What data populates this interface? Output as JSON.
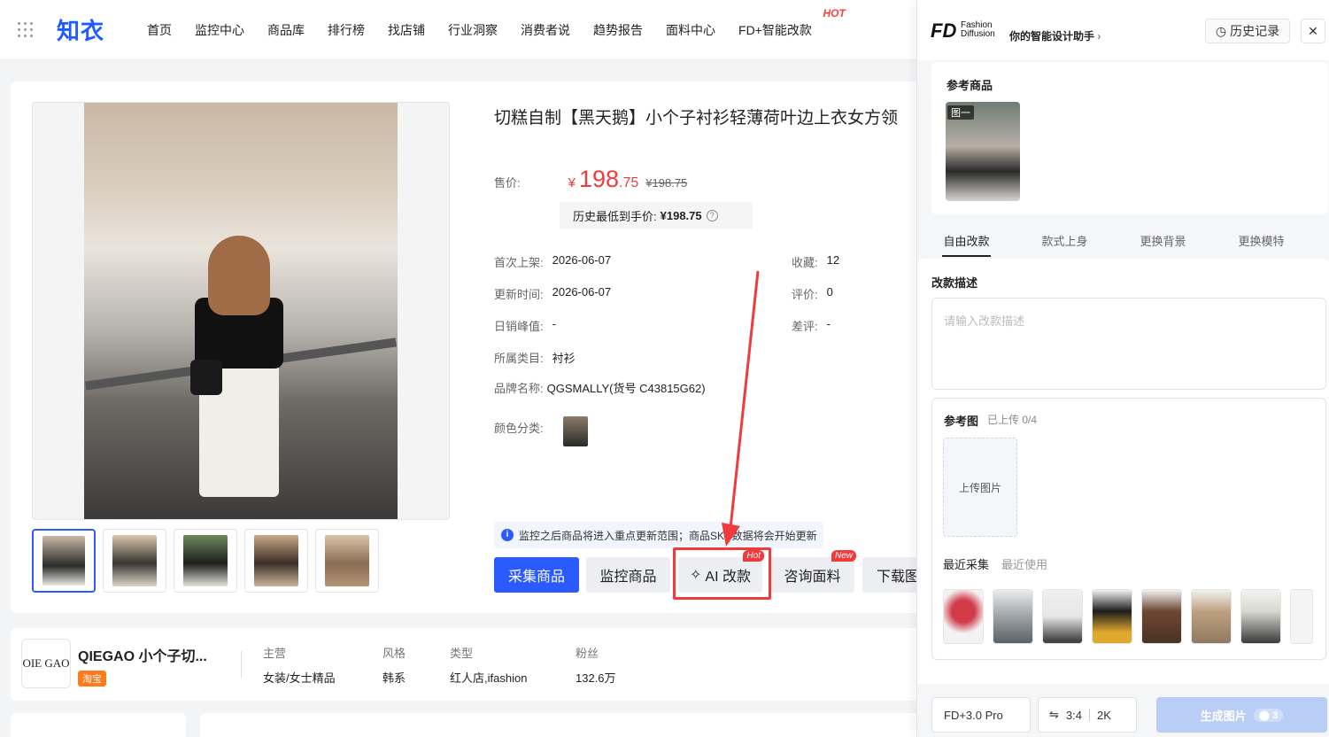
{
  "nav": {
    "logo": "知衣",
    "items": [
      "首页",
      "监控中心",
      "商品库",
      "排行榜",
      "找店铺",
      "行业洞察",
      "消费者说",
      "趋势报告",
      "面料中心",
      "FD+智能改款"
    ],
    "hot_badge": "HOT"
  },
  "product": {
    "title": "切糕自制【黑天鹅】小个子衬衫轻薄荷叶边上衣女方领",
    "price_label": "售价:",
    "currency": "¥",
    "price_int": "198",
    "price_dec": ".75",
    "price_old": "¥198.75",
    "history_label": "历史最低到手价:",
    "history_value": "¥198.75",
    "info_left": [
      {
        "k": "首次上架:",
        "v": "2026-06-07"
      },
      {
        "k": "更新时间:",
        "v": "2026-06-07"
      },
      {
        "k": "日销峰值:",
        "v": "-"
      },
      {
        "k": "所属类目:",
        "v": "衬衫"
      },
      {
        "k": "品牌名称:",
        "v": "QGSMALLY(货号 C43815G62)"
      }
    ],
    "info_right": [
      {
        "k": "收藏:",
        "v": "12"
      },
      {
        "k": "评价:",
        "v": "0"
      },
      {
        "k": "差评:",
        "v": "-"
      }
    ],
    "color_label": "颜色分类:",
    "notice": "监控之后商品将进入重点更新范围；商品SKU数据将会开始更新",
    "buttons": {
      "collect": "采集商品",
      "monitor": "监控商品",
      "ai": "AI 改款",
      "ai_badge": "Hot",
      "fabric": "咨询面料",
      "fabric_badge": "New",
      "download": "下载图"
    }
  },
  "store": {
    "logo_text": "OIE GAO",
    "name": "QIEGAO 小个子切...",
    "platform": "淘宝",
    "fields": [
      {
        "k": "主营",
        "v": "女装/女士精品"
      },
      {
        "k": "风格",
        "v": "韩系"
      },
      {
        "k": "类型",
        "v": "红人店,ifashion"
      },
      {
        "k": "粉丝",
        "v": "132.6万"
      }
    ]
  },
  "panel": {
    "logo": "FD",
    "logo_sub1": "Fashion",
    "logo_sub2": "Diffusion",
    "slogan": "你的智能设计助手",
    "history_btn": "历史记录",
    "ref_title": "参考商品",
    "ref_tag": "图一",
    "tabs": [
      "自由改款",
      "款式上身",
      "更换背景",
      "更换模特"
    ],
    "desc_title": "改款描述",
    "desc_placeholder": "请输入改款描述",
    "refimg_title": "参考图",
    "refimg_count": "已上传 0/4",
    "upload": "上传图片",
    "subtabs": [
      "最近采集",
      "最近使用"
    ],
    "model": "FD+3.0 Pro",
    "ratio": "3:4",
    "resolution": "2K",
    "generate": "生成图片",
    "generate_count": "⬤ 3"
  },
  "colors": {
    "brand_blue": "#2b5bff",
    "price_red": "#ef3b3b",
    "annotation_red": "#ef3b3b"
  }
}
